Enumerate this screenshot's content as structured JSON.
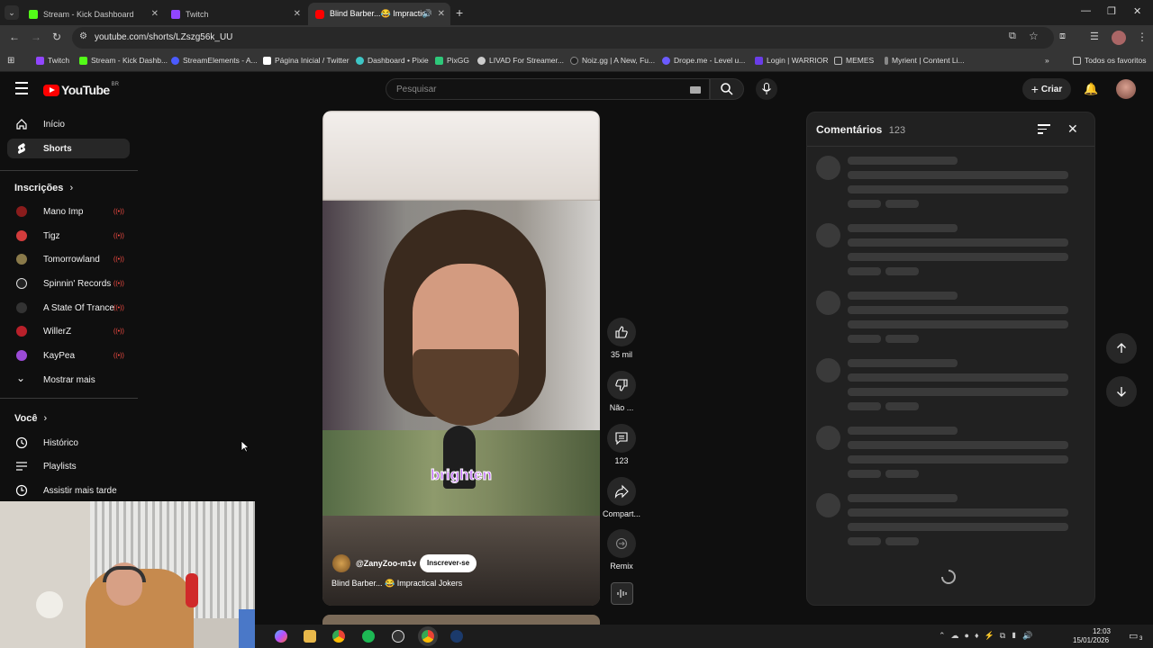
{
  "browser": {
    "tabs": [
      {
        "title": "Stream - Kick Dashboard",
        "color": "#53fc18"
      },
      {
        "title": "Twitch",
        "color": "#9146ff"
      },
      {
        "title": "Blind Barber...😂 Impractic",
        "color": "#ff0000"
      }
    ],
    "url": "youtube.com/shorts/LZszg56k_UU",
    "bookmarks": [
      {
        "label": "Twitch",
        "color": "#9146ff"
      },
      {
        "label": "Stream - Kick Dashb...",
        "color": "#53fc18"
      },
      {
        "label": "StreamElements - A...",
        "color": "#4b5bff"
      },
      {
        "label": "Página Inicial / Twitter",
        "color": "#ffffff"
      },
      {
        "label": "Dashboard • Pixie",
        "color": "#3ec6c6"
      },
      {
        "label": "PixGG",
        "color": "#2ec87a"
      },
      {
        "label": "LIVAD For Streamer...",
        "color": "#cccccc"
      },
      {
        "label": "Noiz.gg | A New, Fu...",
        "color": "#222222"
      },
      {
        "label": "Drope.me - Level u...",
        "color": "#6b5bff"
      },
      {
        "label": "Login | WARRIOR",
        "color": "#6a3de8"
      },
      {
        "label": "MEMES",
        "color": "#bbbbbb"
      },
      {
        "label": "Myrient | Content Li...",
        "color": "#888888"
      }
    ],
    "all_favorites": "Todos os favoritos"
  },
  "youtube": {
    "logo_text": "YouTube",
    "country": "BR",
    "search_placeholder": "Pesquisar",
    "create_label": "Criar"
  },
  "sidebar": {
    "home": "Início",
    "shorts": "Shorts",
    "subs_title": "Inscrições",
    "subscriptions": [
      {
        "name": "Mano Imp",
        "color": "#8a1c1c"
      },
      {
        "name": "Tigz",
        "color": "#d23c3c"
      },
      {
        "name": "Tomorrowland",
        "color": "#8a7a4a"
      },
      {
        "name": "Spinnin' Records",
        "color": "#222222"
      },
      {
        "name": "A State Of Trance",
        "color": "#333333"
      },
      {
        "name": "WillerZ",
        "color": "#b8202a"
      },
      {
        "name": "KayPea",
        "color": "#9b4bd6"
      }
    ],
    "show_more": "Mostrar mais",
    "you_title": "Você",
    "history": "Histórico",
    "playlists": "Playlists",
    "watch_later": "Assistir mais tarde"
  },
  "short": {
    "caption_word": "brighten",
    "channel": "@ZanyZoo-m1v",
    "subscribe": "Inscrever-se",
    "title": "Blind Barber... 😂 Impractical Jokers"
  },
  "actions": {
    "likes": "35 mil",
    "dislike": "Não ...",
    "comments": "123",
    "share": "Compart...",
    "remix": "Remix"
  },
  "comments_panel": {
    "title": "Comentários",
    "count": "123"
  },
  "taskbar": {
    "time": "12:03",
    "date": "15/01/2026",
    "notif": "3"
  }
}
